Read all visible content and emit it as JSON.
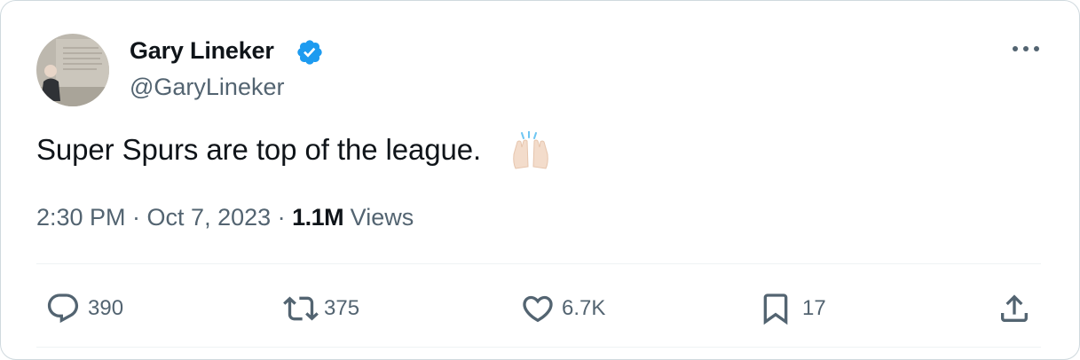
{
  "tweet": {
    "author": {
      "display_name": "Gary Lineker",
      "handle": "@GaryLineker",
      "verified": true
    },
    "text": "Super Spurs are top of the league.",
    "emoji": "raising-hands",
    "timestamp": "2:30 PM · Oct 7, 2023 · ",
    "views_count": "1.1M",
    "views_label": " Views"
  },
  "actions": {
    "replies": "390",
    "reposts": "375",
    "likes": "6.7K",
    "bookmarks": "17"
  },
  "colors": {
    "text_primary": "#0f1419",
    "text_secondary": "#536471",
    "verified_blue": "#1d9bf0",
    "divider": "#eff3f4"
  }
}
